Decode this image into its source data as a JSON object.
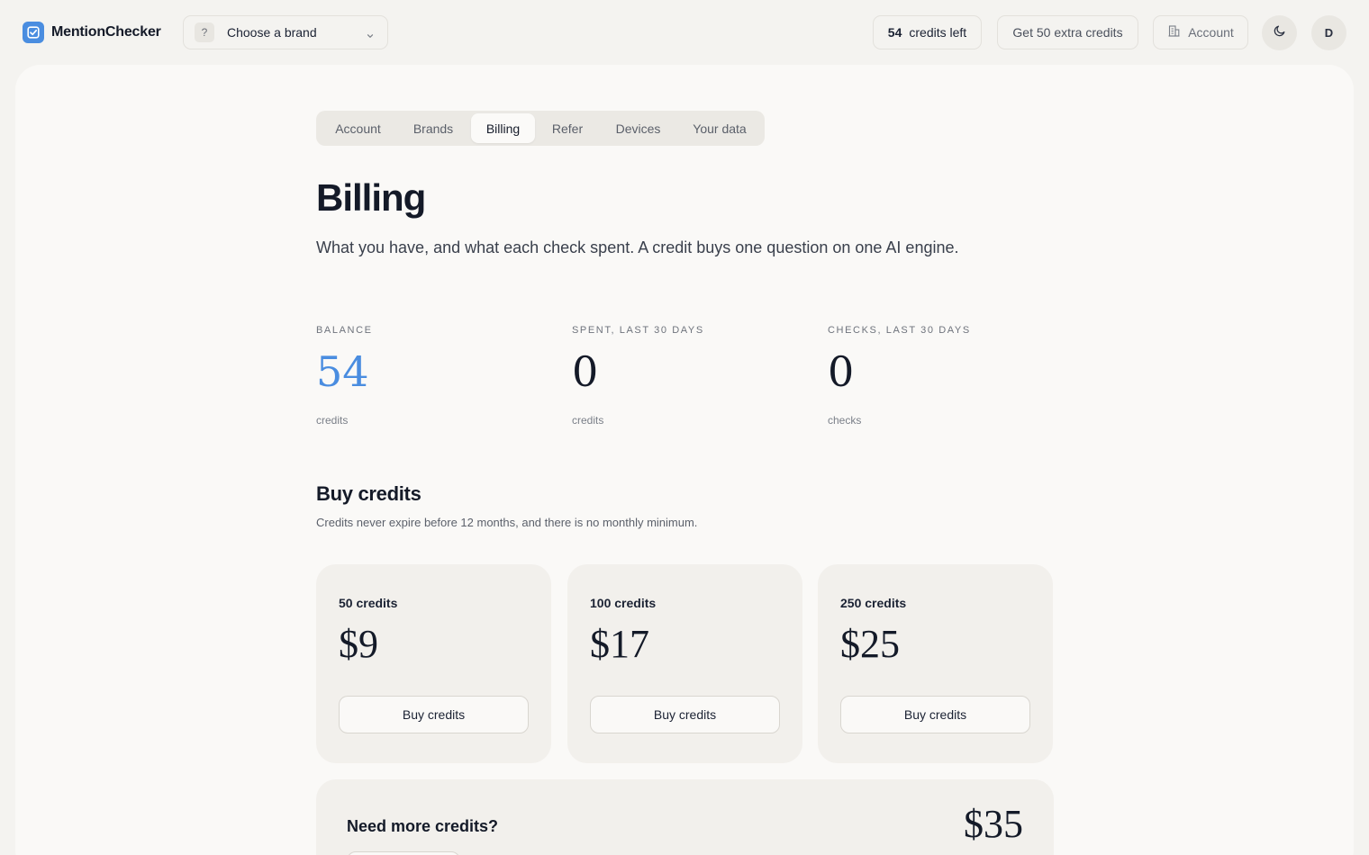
{
  "app": {
    "name": "MentionChecker"
  },
  "header": {
    "brand_select": {
      "badge": "?",
      "label": "Choose a brand"
    },
    "credits_left": {
      "count": "54",
      "label": "credits left"
    },
    "extra_credits_label": "Get 50 extra credits",
    "account_label": "Account",
    "avatar_initial": "D"
  },
  "tabs": [
    {
      "label": "Account",
      "active": false
    },
    {
      "label": "Brands",
      "active": false
    },
    {
      "label": "Billing",
      "active": true
    },
    {
      "label": "Refer",
      "active": false
    },
    {
      "label": "Devices",
      "active": false
    },
    {
      "label": "Your data",
      "active": false
    }
  ],
  "page": {
    "title": "Billing",
    "subtitle": "What you have, and what each check spent. A credit buys one question on one AI engine."
  },
  "stats": [
    {
      "label": "BALANCE",
      "value": "54",
      "unit": "credits"
    },
    {
      "label": "SPENT, LAST 30 DAYS",
      "value": "0",
      "unit": "credits"
    },
    {
      "label": "CHECKS, LAST 30 DAYS",
      "value": "0",
      "unit": "checks"
    }
  ],
  "buy": {
    "title": "Buy credits",
    "subtitle": "Credits never expire before 12 months, and there is no monthly minimum.",
    "packs": [
      {
        "name": "50 credits",
        "price": "$9",
        "button": "Buy credits"
      },
      {
        "name": "100 credits",
        "price": "$17",
        "button": "Buy credits"
      },
      {
        "name": "250 credits",
        "price": "$25",
        "button": "Buy credits"
      }
    ],
    "more": {
      "title": "Need more credits?",
      "price": "$35"
    }
  },
  "colors": {
    "accent": "#4a8de0",
    "page_background": "#f4f3f0",
    "card_background": "#faf9f7",
    "text_primary": "#141a28"
  },
  "icons": {
    "logo": "checkbox-check-icon",
    "brand_dropdown": "chevron-down-icon",
    "account": "building-icon",
    "theme": "moon-icon"
  }
}
